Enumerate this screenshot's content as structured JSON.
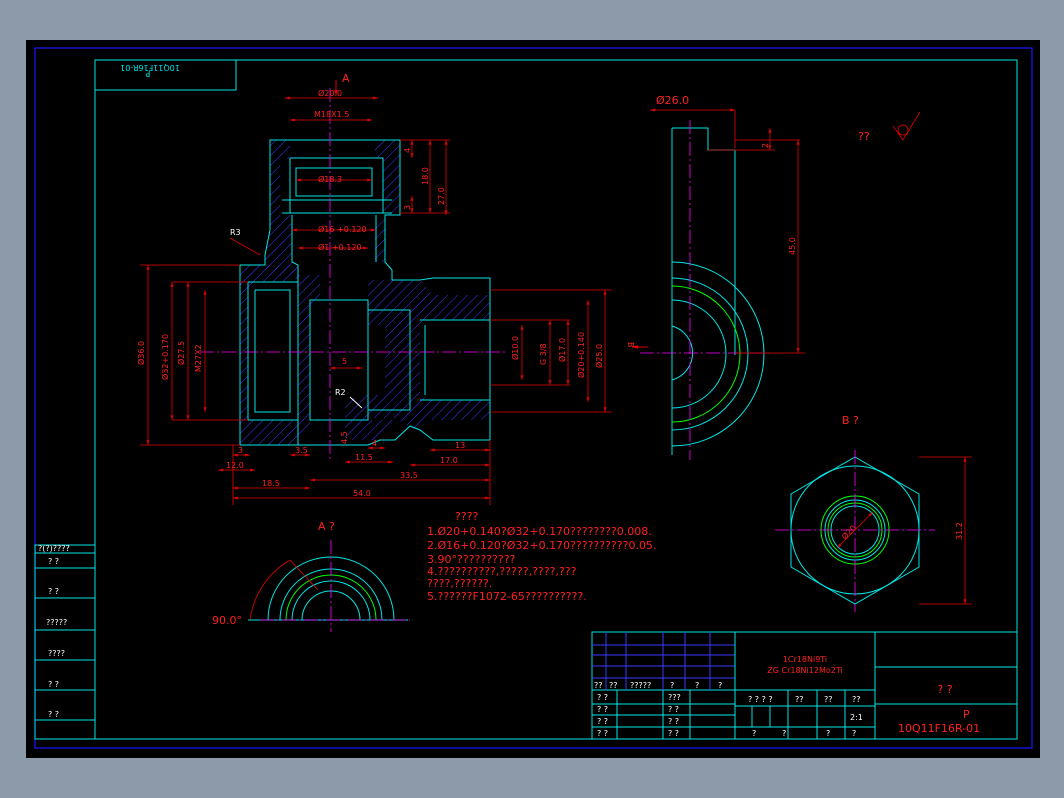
{
  "title_block": {
    "stamp_mirrored": "10Q11F16R-01",
    "stamp_letter": "P",
    "drawing_no": "10Q11F16R-01",
    "drawing_letter": "P",
    "part_name": "?  ?",
    "material_line1": "1Cr18Ni9Ti",
    "material_line2": "ZG  Cr18Ni12Mo2Ti",
    "scale": "2:1",
    "header_cells": [
      "??",
      "??",
      "?????",
      "?",
      "?",
      "?"
    ],
    "row_cells_a": [
      "? ?",
      "???"
    ],
    "row_cells_b": [
      "? ?",
      "? ?"
    ],
    "row_cells_c": [
      "? ?",
      "? ?"
    ],
    "row_cells_d": [
      "? ?",
      "? ?"
    ],
    "weight_cells": [
      "? ? ? ?",
      "??",
      "??",
      "??"
    ],
    "sheet_cells": [
      "?",
      "?",
      "?",
      "?"
    ]
  },
  "side_table": {
    "title": "?(?)????",
    "rows": [
      "?   ?",
      "?   ?",
      "?????",
      "????",
      "?   ?",
      "?   ?"
    ]
  },
  "labels": {
    "roughness": "??",
    "view_a_arrow": "A",
    "view_b_arrow": "B",
    "section_a": "A  ?",
    "section_b": "B  ?",
    "angle": "90.0°",
    "r3": "R3",
    "r2": "R2"
  },
  "dimensions": {
    "d20": "Ø20.0",
    "m18": "M18X1.5",
    "d18_3": "Ø18.3",
    "d16_tol": "Ø16 +0.120",
    "d1_tol": "Ø1  +0.120",
    "d36": "Ø36.0",
    "d32_tol": "Ø32+0.170",
    "d27_5": "Ø27.5",
    "m27": "M27X2",
    "d10": "Ø10.0",
    "g38": "G 3/8",
    "d17": "Ø17.0",
    "d20_tol": "Ø20+0.140",
    "d25": "Ø25.0",
    "d26": "Ø26.0",
    "h2": "2",
    "h45": "45.0",
    "h31_2": "31.2",
    "h18": "18.0",
    "h27": "27.0",
    "h3": "3",
    "h4": "4",
    "dim_3": "3",
    "dim_12": "12.0",
    "dim_3_5": "3.5",
    "dim_18_5": "18.5",
    "dim_11_5": "11.5",
    "dim_4": "4",
    "dim_4_5": "4.5",
    "dim_5": "5",
    "dim_13": "13",
    "dim_17": "17.0",
    "dim_33_5": "33.5",
    "dim_54": "54.0",
    "d20_hex": "Ø20"
  },
  "notes": {
    "heading": "????",
    "lines": [
      "1.Ø20+0.140?Ø32+0.170????????0.008.",
      "2.Ø16+0.120?Ø32+0.170??????????0.05.",
      "3.90°??????????",
      "4.??????????,?????,????,???",
      "   ????,??????.",
      "5.??????F1072-65??????????."
    ]
  },
  "colors": {
    "background": "#000000",
    "outline": "#00e5e5",
    "dimension": "#e60000",
    "hatch": "#3a3aff",
    "centerline": "#ff00ff",
    "thread": "#00ff00"
  }
}
